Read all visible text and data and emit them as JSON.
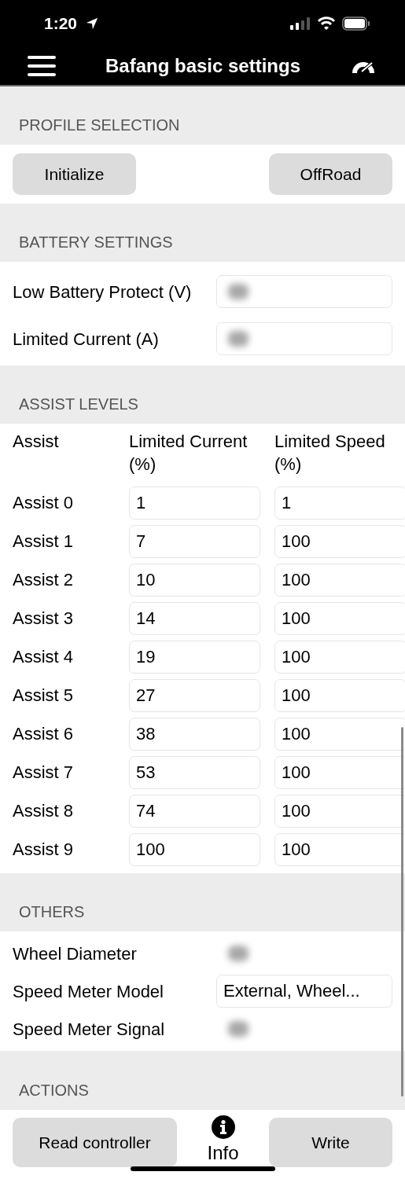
{
  "status_bar": {
    "time": "1:20"
  },
  "header": {
    "title": "Bafang basic settings"
  },
  "profile_selection": {
    "heading": "PROFILE SELECTION",
    "buttons": [
      "Initialize",
      "OffRoad"
    ]
  },
  "battery_settings": {
    "heading": "BATTERY SETTINGS",
    "fields": [
      {
        "label": "Low Battery Protect (V)",
        "kind": "blurred"
      },
      {
        "label": "Limited Current (A)",
        "kind": "blurred"
      }
    ]
  },
  "assist_levels": {
    "heading": "ASSIST LEVELS",
    "columns": [
      "Assist",
      "Limited Current (%)",
      "Limited Speed (%)"
    ],
    "rows": [
      {
        "assist": "Assist 0",
        "current": "1",
        "speed": "1"
      },
      {
        "assist": "Assist 1",
        "current": "7",
        "speed": "100"
      },
      {
        "assist": "Assist 2",
        "current": "10",
        "speed": "100"
      },
      {
        "assist": "Assist 3",
        "current": "14",
        "speed": "100"
      },
      {
        "assist": "Assist 4",
        "current": "19",
        "speed": "100"
      },
      {
        "assist": "Assist 5",
        "current": "27",
        "speed": "100"
      },
      {
        "assist": "Assist 6",
        "current": "38",
        "speed": "100"
      },
      {
        "assist": "Assist 7",
        "current": "53",
        "speed": "100"
      },
      {
        "assist": "Assist 8",
        "current": "74",
        "speed": "100"
      },
      {
        "assist": "Assist 9",
        "current": "100",
        "speed": "100"
      }
    ]
  },
  "others": {
    "heading": "OTHERS",
    "fields": [
      {
        "label": "Wheel Diameter",
        "kind": "blurred"
      },
      {
        "label": "Speed Meter Model",
        "kind": "select",
        "value": "External, Wheel..."
      },
      {
        "label": "Speed Meter Signal",
        "kind": "blurred"
      }
    ]
  },
  "actions": {
    "heading": "ACTIONS",
    "read_button": "Read controller",
    "info_label": "Info",
    "write_button": "Write"
  }
}
